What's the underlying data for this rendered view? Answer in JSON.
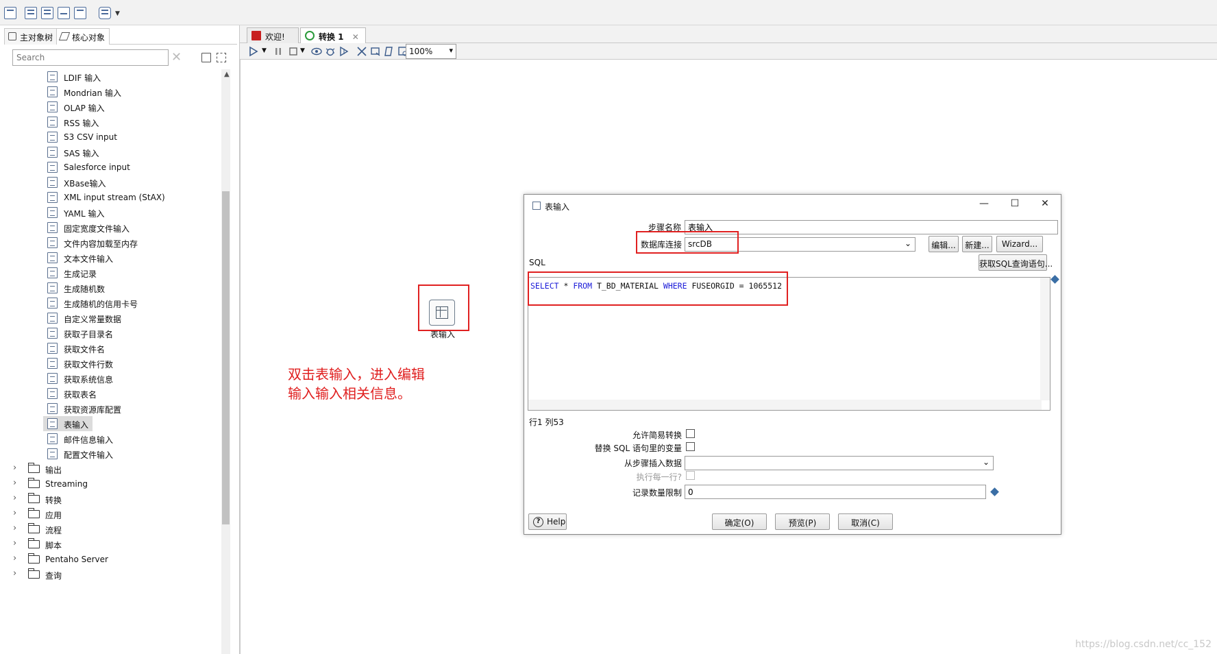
{
  "left_panel": {
    "tabs": [
      "主对象树",
      "核心对象"
    ],
    "search_placeholder": "Search",
    "items": [
      "LDIF 输入",
      "Mondrian 输入",
      "OLAP 输入",
      "RSS 输入",
      "S3 CSV input",
      "SAS 输入",
      "Salesforce input",
      "XBase输入",
      "XML input stream (StAX)",
      "YAML 输入",
      "固定宽度文件输入",
      "文件内容加载至内存",
      "文本文件输入",
      "生成记录",
      "生成随机数",
      "生成随机的信用卡号",
      "自定义常量数据",
      "获取子目录名",
      "获取文件名",
      "获取文件行数",
      "获取系统信息",
      "获取表名",
      "获取资源库配置",
      "表输入",
      "邮件信息输入",
      "配置文件输入"
    ],
    "selected_item": "表输入",
    "folders": [
      "输出",
      "Streaming",
      "转换",
      "应用",
      "流程",
      "脚本",
      "Pentaho Server",
      "查询"
    ]
  },
  "canvas_tabs": [
    {
      "label": "欢迎!",
      "close": ""
    },
    {
      "label": "转换 1",
      "close": "✕"
    }
  ],
  "canvas_toolbar": {
    "zoom": "100%"
  },
  "canvas": {
    "step_label": "表输入",
    "annotation_line1": "双击表输入，进入编辑",
    "annotation_line2": "输入输入相关信息。"
  },
  "dialog": {
    "title": "表输入",
    "step_name_label": "步骤名称",
    "step_name_value": "表输入",
    "db_conn_label": "数据库连接",
    "db_conn_value": "srcDB",
    "edit_btn": "编辑...",
    "new_btn": "新建...",
    "wizard_btn": "Wizard...",
    "sql_label": "SQL",
    "get_sql_btn": "获取SQL查询语句...",
    "sql_tokens": [
      {
        "t": "SELECT",
        "kw": true
      },
      {
        "t": " * ",
        "kw": false
      },
      {
        "t": "FROM",
        "kw": true
      },
      {
        "t": " T_BD_MATERIAL ",
        "kw": false
      },
      {
        "t": "WHERE",
        "kw": true
      },
      {
        "t": " FUSEORGID = 1065512",
        "kw": false
      }
    ],
    "cursor_pos": "行1 列53",
    "allow_lazy_label": "允许简易转换",
    "replace_vars_label": "替换 SQL 语句里的变量",
    "insert_from_label": "从步骤插入数据",
    "exec_each_row_label": "执行每一行?",
    "limit_label": "记录数量限制",
    "limit_value": "0",
    "help_btn": "Help",
    "ok_btn": "确定(O)",
    "preview_btn": "预览(P)",
    "cancel_btn": "取消(C)"
  },
  "watermark": "https://blog.csdn.net/cc_152",
  "colors": {
    "annotation_red": "#e02020",
    "sql_keyword": "#1a1ad8"
  }
}
